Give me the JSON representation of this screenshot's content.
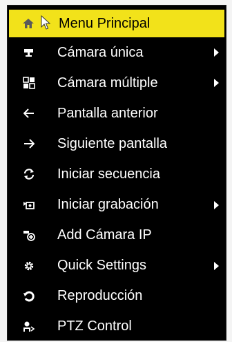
{
  "menu": {
    "items": [
      {
        "label": "Menu Principal",
        "icon": "home-icon",
        "submenu": false,
        "highlighted": true
      },
      {
        "label": "Cámara única",
        "icon": "camera-icon",
        "submenu": true
      },
      {
        "label": "Cámara múltiple",
        "icon": "multi-camera-icon",
        "submenu": true
      },
      {
        "label": "Pantalla anterior",
        "icon": "arrow-left-icon",
        "submenu": false
      },
      {
        "label": "Siguiente pantalla",
        "icon": "arrow-right-icon",
        "submenu": false
      },
      {
        "label": "Iniciar secuencia",
        "icon": "refresh-icon",
        "submenu": false
      },
      {
        "label": "Iniciar grabación",
        "icon": "record-icon",
        "submenu": true
      },
      {
        "label": "Add Cámara IP",
        "icon": "add-camera-icon",
        "submenu": false
      },
      {
        "label": "Quick Settings",
        "icon": "gear-icon",
        "submenu": true
      },
      {
        "label": "Reproducción",
        "icon": "playback-icon",
        "submenu": false
      },
      {
        "label": "PTZ Control",
        "icon": "ptz-icon",
        "submenu": false
      }
    ]
  },
  "colors": {
    "highlight": "#f2e21a",
    "background": "#000000",
    "text": "#ffffff"
  }
}
